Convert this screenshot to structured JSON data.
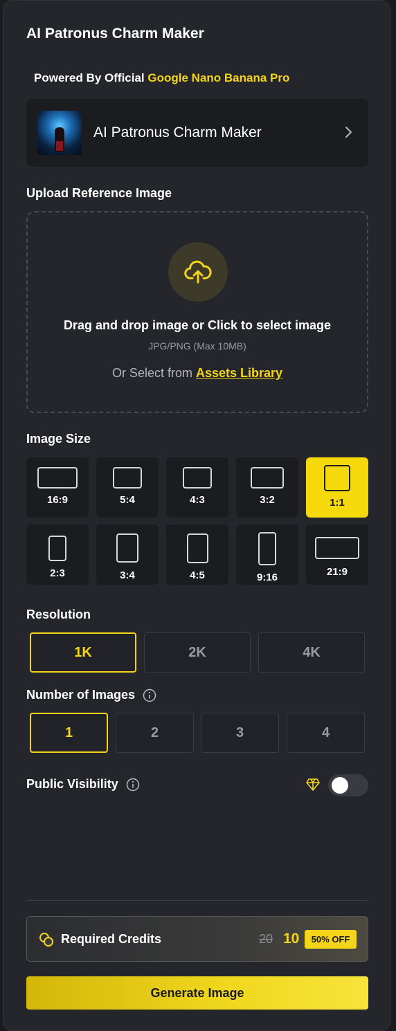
{
  "page_title": "AI Patronus Charm Maker",
  "powered_by": {
    "prefix": "Powered By Official",
    "model": "Google Nano Banana Pro"
  },
  "tool_card": {
    "name": "AI Patronus Charm Maker"
  },
  "upload": {
    "label": "Upload Reference Image",
    "main_text": "Drag and drop image or Click to select image",
    "sub_text": "JPG/PNG (Max 10MB)",
    "or_text": "Or Select from",
    "library_link": "Assets Library"
  },
  "image_size": {
    "label": "Image Size",
    "options": [
      "16:9",
      "5:4",
      "4:3",
      "3:2",
      "1:1",
      "2:3",
      "3:4",
      "4:5",
      "9:16",
      "21:9"
    ],
    "selected": "1:1"
  },
  "resolution": {
    "label": "Resolution",
    "options": [
      "1K",
      "2K",
      "4K"
    ],
    "selected": "1K"
  },
  "num_images": {
    "label": "Number of Images",
    "options": [
      "1",
      "2",
      "3",
      "4"
    ],
    "selected": "1"
  },
  "visibility": {
    "label": "Public Visibility",
    "enabled": false
  },
  "credits": {
    "label": "Required Credits",
    "original": "20",
    "price": "10",
    "discount": "50% OFF"
  },
  "generate_label": "Generate Image",
  "colors": {
    "accent": "#f5d519",
    "panel": "#25262c",
    "card": "#1b1c20"
  }
}
